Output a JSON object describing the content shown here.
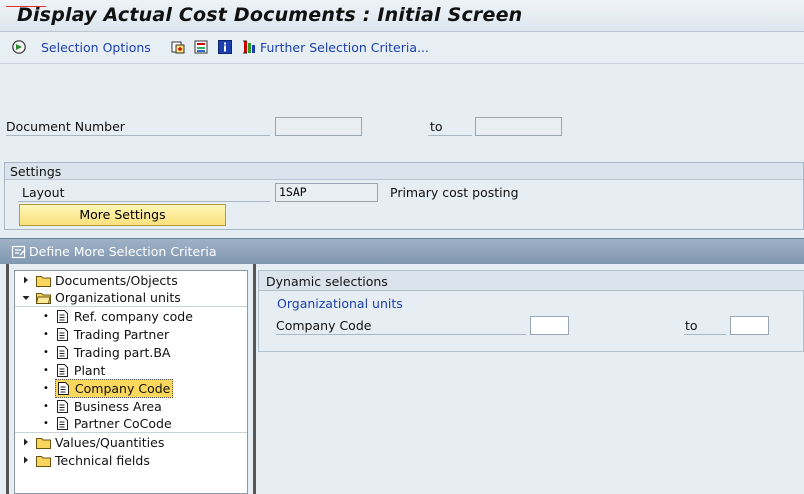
{
  "title": "Display Actual Cost Documents : Initial Screen",
  "toolbar": {
    "selection_options": "Selection Options",
    "further_selection": "Further Selection Criteria..."
  },
  "document_number": {
    "label": "Document Number",
    "from_value": "",
    "to_label": "to",
    "to_value": ""
  },
  "settings": {
    "header": "Settings",
    "layout_label": "Layout",
    "layout_value": "1SAP",
    "layout_desc": "Primary cost posting",
    "more_button": "More Settings"
  },
  "more_criteria": {
    "header": "Define More Selection Criteria"
  },
  "tree": {
    "items": [
      {
        "label": "Documents/Objects",
        "type": "folder",
        "state": "collapsed"
      },
      {
        "label": "Organizational units",
        "type": "folder",
        "state": "expanded"
      },
      {
        "label": "Ref. company code",
        "type": "leaf"
      },
      {
        "label": "Trading Partner",
        "type": "leaf"
      },
      {
        "label": "Trading part.BA",
        "type": "leaf"
      },
      {
        "label": "Plant",
        "type": "leaf"
      },
      {
        "label": "Company Code",
        "type": "leaf",
        "selected": true
      },
      {
        "label": "Business Area",
        "type": "leaf"
      },
      {
        "label": "Partner CoCode",
        "type": "leaf"
      },
      {
        "label": "Values/Quantities",
        "type": "folder",
        "state": "collapsed"
      },
      {
        "label": "Technical fields",
        "type": "folder",
        "state": "collapsed"
      }
    ]
  },
  "dynamic": {
    "header": "Dynamic selections",
    "group_label": "Organizational units",
    "field_label": "Company Code",
    "from_value": "",
    "to_label": "to",
    "to_value": ""
  },
  "colors": {
    "link_blue": "#1b3fae",
    "highlight": "#fbd75b",
    "header_blue": "#8aa1b9"
  }
}
